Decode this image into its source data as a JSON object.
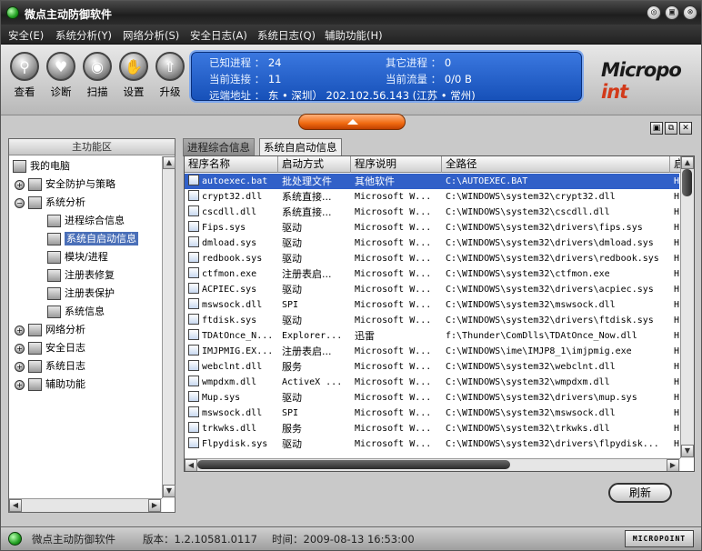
{
  "window": {
    "title": "微点主动防御软件",
    "buttons": [
      "◎",
      "▣",
      "⊗"
    ]
  },
  "menu": [
    "安全(E)",
    "系统分析(Y)",
    "网络分析(S)",
    "安全日志(A)",
    "系统日志(Q)",
    "辅助功能(H)"
  ],
  "toolbar": [
    {
      "label": "查看",
      "icon": "magnifier-icon"
    },
    {
      "label": "诊断",
      "icon": "heart-icon"
    },
    {
      "label": "扫描",
      "icon": "scan-icon"
    },
    {
      "label": "设置",
      "icon": "hand-icon"
    },
    {
      "label": "升级",
      "icon": "upgrade-arrow-icon"
    }
  ],
  "stats": {
    "known_process_label": "已知进程 ：",
    "known_process": "24",
    "other_process_label": "其它进程 ：",
    "other_process": "0",
    "connections_label": "当前连接 ：",
    "connections": "11",
    "traffic_label": "当前流量 ：",
    "traffic": "0/0 B",
    "remote_label": "远端地址 ：",
    "remote": "东 • 深圳）    202.102.56.143 (江苏 • 常州)"
  },
  "logo": {
    "text_a": "Micropo",
    "text_b": "int"
  },
  "left_panel": {
    "header": "主功能区",
    "tree": [
      {
        "label": "我的电脑",
        "level": 0,
        "expander": ""
      },
      {
        "label": "安全防护与策略",
        "level": 1,
        "expander": "+"
      },
      {
        "label": "系统分析",
        "level": 1,
        "expander": "−"
      },
      {
        "label": "进程综合信息",
        "level": 2,
        "expander": ""
      },
      {
        "label": "系统自启动信息",
        "level": 2,
        "expander": "",
        "selected": true
      },
      {
        "label": "模块/进程",
        "level": 2,
        "expander": ""
      },
      {
        "label": "注册表修复",
        "level": 2,
        "expander": ""
      },
      {
        "label": "注册表保护",
        "level": 2,
        "expander": ""
      },
      {
        "label": "系统信息",
        "level": 2,
        "expander": ""
      },
      {
        "label": "网络分析",
        "level": 1,
        "expander": "+"
      },
      {
        "label": "安全日志",
        "level": 1,
        "expander": "+"
      },
      {
        "label": "系统日志",
        "level": 1,
        "expander": "+"
      },
      {
        "label": "辅助功能",
        "level": 1,
        "expander": "+"
      }
    ]
  },
  "tabs": [
    "进程综合信息",
    "系统自启动信息"
  ],
  "table": {
    "columns": [
      "程序名称",
      "启动方式",
      "程序说明",
      "全路径",
      "启"
    ],
    "rows": [
      [
        "autoexec.bat",
        "批处理文件",
        "其他软件",
        "C:\\AUTOEXEC.BAT",
        "H"
      ],
      [
        "crypt32.dll",
        "系统直接...",
        "Microsoft W...",
        "C:\\WINDOWS\\system32\\crypt32.dll",
        "H"
      ],
      [
        "cscdll.dll",
        "系统直接...",
        "Microsoft W...",
        "C:\\WINDOWS\\system32\\cscdll.dll",
        "H"
      ],
      [
        "Fips.sys",
        "驱动",
        "Microsoft W...",
        "C:\\WINDOWS\\system32\\drivers\\fips.sys",
        "H"
      ],
      [
        "dmload.sys",
        "驱动",
        "Microsoft W...",
        "C:\\WINDOWS\\system32\\drivers\\dmload.sys",
        "H"
      ],
      [
        "redbook.sys",
        "驱动",
        "Microsoft W...",
        "C:\\WINDOWS\\system32\\drivers\\redbook.sys",
        "H"
      ],
      [
        "ctfmon.exe",
        "注册表启...",
        "Microsoft W...",
        "C:\\WINDOWS\\system32\\ctfmon.exe",
        "H"
      ],
      [
        "ACPIEC.sys",
        "驱动",
        "Microsoft W...",
        "C:\\WINDOWS\\system32\\drivers\\acpiec.sys",
        "H"
      ],
      [
        "mswsock.dll",
        "SPI",
        "Microsoft W...",
        "C:\\WINDOWS\\system32\\mswsock.dll",
        "H"
      ],
      [
        "ftdisk.sys",
        "驱动",
        "Microsoft W...",
        "C:\\WINDOWS\\system32\\drivers\\ftdisk.sys",
        "H"
      ],
      [
        "TDAtOnce_N...",
        "Explorer...",
        "迅雷",
        "f:\\Thunder\\ComDlls\\TDAtOnce_Now.dll",
        "H"
      ],
      [
        "IMJPMIG.EX...",
        "注册表启...",
        "Microsoft W...",
        "C:\\WINDOWS\\ime\\IMJP8_1\\imjpmig.exe",
        "H"
      ],
      [
        "webclnt.dll",
        "服务",
        "Microsoft W...",
        "C:\\WINDOWS\\system32\\webclnt.dll",
        "H"
      ],
      [
        "wmpdxm.dll",
        "ActiveX ...",
        "Microsoft W...",
        "C:\\WINDOWS\\system32\\wmpdxm.dll",
        "H"
      ],
      [
        "Mup.sys",
        "驱动",
        "Microsoft W...",
        "C:\\WINDOWS\\system32\\drivers\\mup.sys",
        "H"
      ],
      [
        "mswsock.dll",
        "SPI",
        "Microsoft W...",
        "C:\\WINDOWS\\system32\\mswsock.dll",
        "H"
      ],
      [
        "trkwks.dll",
        "服务",
        "Microsoft W...",
        "C:\\WINDOWS\\system32\\trkwks.dll",
        "H"
      ],
      [
        "Flpydisk.sys",
        "驱动",
        "Microsoft W...",
        "C:\\WINDOWS\\system32\\drivers\\flpydisk...",
        "H"
      ]
    ]
  },
  "refresh_label": "刷新",
  "statusbar": {
    "app": "微点主动防御软件",
    "version": "版本：1.2.10581.0117",
    "time": "时间：2009-08-13 16:53:00",
    "brand": "MICROPOINT"
  }
}
